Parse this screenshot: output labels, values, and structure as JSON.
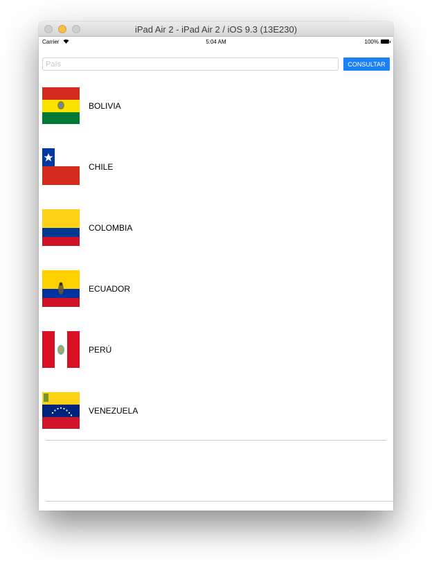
{
  "window": {
    "title": "iPad Air 2 - iPad Air 2 / iOS 9.3 (13E230)"
  },
  "status_bar": {
    "carrier": "Carrier",
    "wifi_icon": "wifi-icon",
    "time": "5:04 AM",
    "battery": "100%"
  },
  "search": {
    "placeholder": "País",
    "value": "",
    "button_label": "CONSULTAR",
    "button_color": "#1a82f6"
  },
  "countries": [
    {
      "name": "BOLIVIA",
      "flag": "bolivia-flag"
    },
    {
      "name": "CHILE",
      "flag": "chile-flag"
    },
    {
      "name": "COLOMBIA",
      "flag": "colombia-flag"
    },
    {
      "name": "ECUADOR",
      "flag": "ecuador-flag"
    },
    {
      "name": "PERÚ",
      "flag": "peru-flag"
    },
    {
      "name": "VENEZUELA",
      "flag": "venezuela-flag"
    }
  ]
}
